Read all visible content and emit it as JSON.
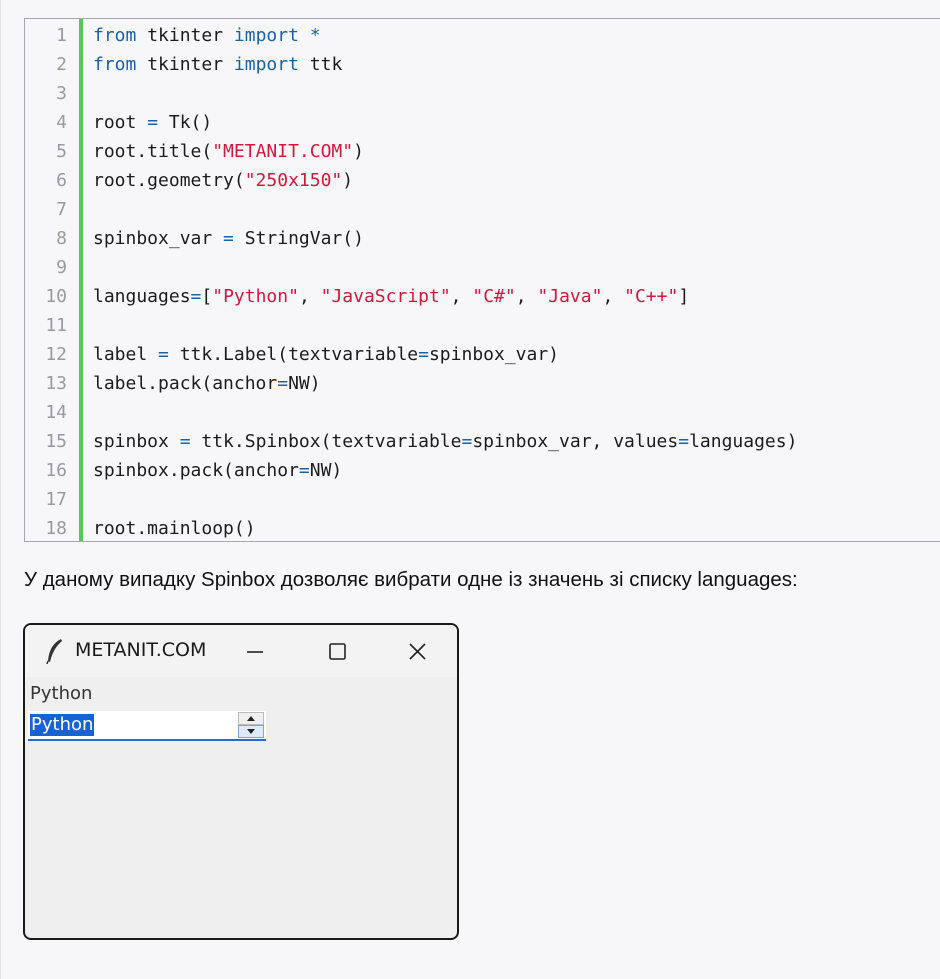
{
  "code": {
    "lines": [
      {
        "n": "1",
        "parts": [
          {
            "t": "from",
            "c": "kw"
          },
          {
            "t": " tkinter ",
            "c": ""
          },
          {
            "t": "import",
            "c": "kw"
          },
          {
            "t": " ",
            "c": ""
          },
          {
            "t": "*",
            "c": "op"
          }
        ]
      },
      {
        "n": "2",
        "parts": [
          {
            "t": "from",
            "c": "kw"
          },
          {
            "t": " tkinter ",
            "c": ""
          },
          {
            "t": "import",
            "c": "kw"
          },
          {
            "t": " ttk",
            "c": ""
          }
        ]
      },
      {
        "n": "3",
        "parts": []
      },
      {
        "n": "4",
        "parts": [
          {
            "t": "root ",
            "c": ""
          },
          {
            "t": "=",
            "c": "op"
          },
          {
            "t": " Tk()",
            "c": ""
          }
        ]
      },
      {
        "n": "5",
        "parts": [
          {
            "t": "root.title(",
            "c": ""
          },
          {
            "t": "\"METANIT.COM\"",
            "c": "str"
          },
          {
            "t": ")",
            "c": ""
          }
        ]
      },
      {
        "n": "6",
        "parts": [
          {
            "t": "root.geometry(",
            "c": ""
          },
          {
            "t": "\"250x150\"",
            "c": "str"
          },
          {
            "t": ")",
            "c": ""
          }
        ]
      },
      {
        "n": "7",
        "parts": []
      },
      {
        "n": "8",
        "parts": [
          {
            "t": "spinbox_var ",
            "c": ""
          },
          {
            "t": "=",
            "c": "op"
          },
          {
            "t": " StringVar()",
            "c": ""
          }
        ]
      },
      {
        "n": "9",
        "parts": []
      },
      {
        "n": "10",
        "parts": [
          {
            "t": "languages",
            "c": ""
          },
          {
            "t": "=",
            "c": "op"
          },
          {
            "t": "[",
            "c": ""
          },
          {
            "t": "\"Python\"",
            "c": "str"
          },
          {
            "t": ", ",
            "c": ""
          },
          {
            "t": "\"JavaScript\"",
            "c": "str"
          },
          {
            "t": ", ",
            "c": ""
          },
          {
            "t": "\"C#\"",
            "c": "str"
          },
          {
            "t": ", ",
            "c": ""
          },
          {
            "t": "\"Java\"",
            "c": "str"
          },
          {
            "t": ", ",
            "c": ""
          },
          {
            "t": "\"C++\"",
            "c": "str"
          },
          {
            "t": "]",
            "c": ""
          }
        ]
      },
      {
        "n": "11",
        "parts": []
      },
      {
        "n": "12",
        "parts": [
          {
            "t": "label ",
            "c": ""
          },
          {
            "t": "=",
            "c": "op"
          },
          {
            "t": " ttk.Label(textvariable",
            "c": ""
          },
          {
            "t": "=",
            "c": "op"
          },
          {
            "t": "spinbox_var)",
            "c": ""
          }
        ]
      },
      {
        "n": "13",
        "parts": [
          {
            "t": "label.pack(anchor",
            "c": ""
          },
          {
            "t": "=",
            "c": "op"
          },
          {
            "t": "NW)",
            "c": ""
          }
        ]
      },
      {
        "n": "14",
        "parts": []
      },
      {
        "n": "15",
        "parts": [
          {
            "t": "spinbox ",
            "c": ""
          },
          {
            "t": "=",
            "c": "op"
          },
          {
            "t": " ttk.Spinbox(textvariable",
            "c": ""
          },
          {
            "t": "=",
            "c": "op"
          },
          {
            "t": "spinbox_var, values",
            "c": ""
          },
          {
            "t": "=",
            "c": "op"
          },
          {
            "t": "languages)",
            "c": ""
          }
        ]
      },
      {
        "n": "16",
        "parts": [
          {
            "t": "spinbox.pack(anchor",
            "c": ""
          },
          {
            "t": "=",
            "c": "op"
          },
          {
            "t": "NW)",
            "c": ""
          }
        ]
      },
      {
        "n": "17",
        "parts": []
      },
      {
        "n": "18",
        "parts": [
          {
            "t": "root.mainloop()",
            "c": ""
          }
        ]
      }
    ]
  },
  "paragraph": "У даному випадку Spinbox дозволяє вибрати одне із значень зі списку languages:",
  "tk_window": {
    "title": "METANIT.COM",
    "icon": "feather-icon",
    "label_text": "Python",
    "spinbox_value": "Python"
  },
  "colors": {
    "gutter_accent": "#5ac75a",
    "keyword": "#1862a8",
    "string": "#d4183d",
    "selection": "#1763d3"
  }
}
